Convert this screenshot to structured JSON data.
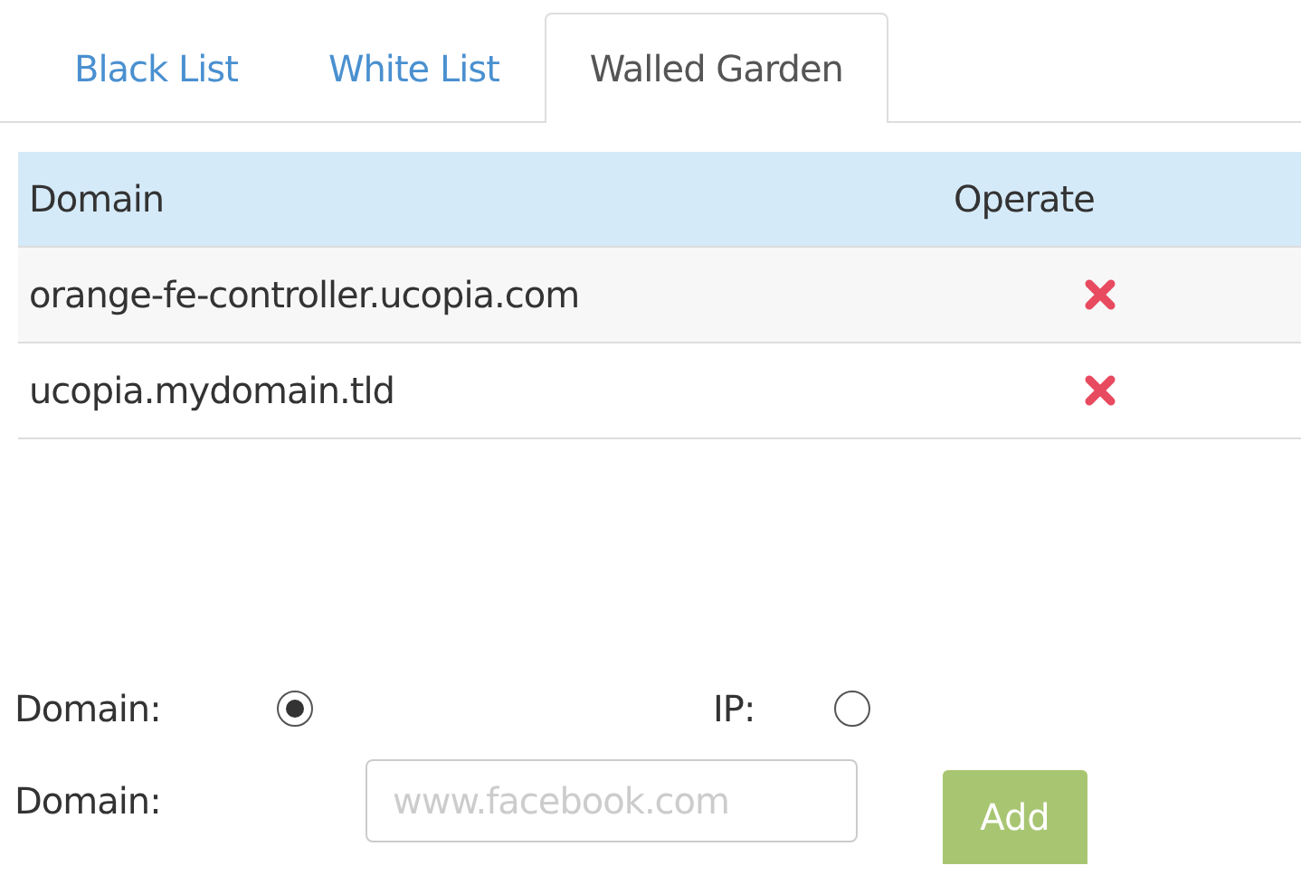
{
  "tabs": [
    {
      "label": "Black List",
      "selected": false
    },
    {
      "label": "White List",
      "selected": false
    },
    {
      "label": "Walled Garden",
      "selected": true
    }
  ],
  "table": {
    "columns": [
      "Domain",
      "Operate"
    ],
    "rows": [
      {
        "domain": "orange-fe-controller.ucopia.com"
      },
      {
        "domain": "ucopia.mydomain.tld"
      }
    ]
  },
  "form": {
    "options": [
      {
        "label": "Domain:",
        "selected": true
      },
      {
        "label": "IP:",
        "selected": false
      }
    ],
    "field_label": "Domain:",
    "placeholder": "www.facebook.com",
    "button": "Add"
  }
}
